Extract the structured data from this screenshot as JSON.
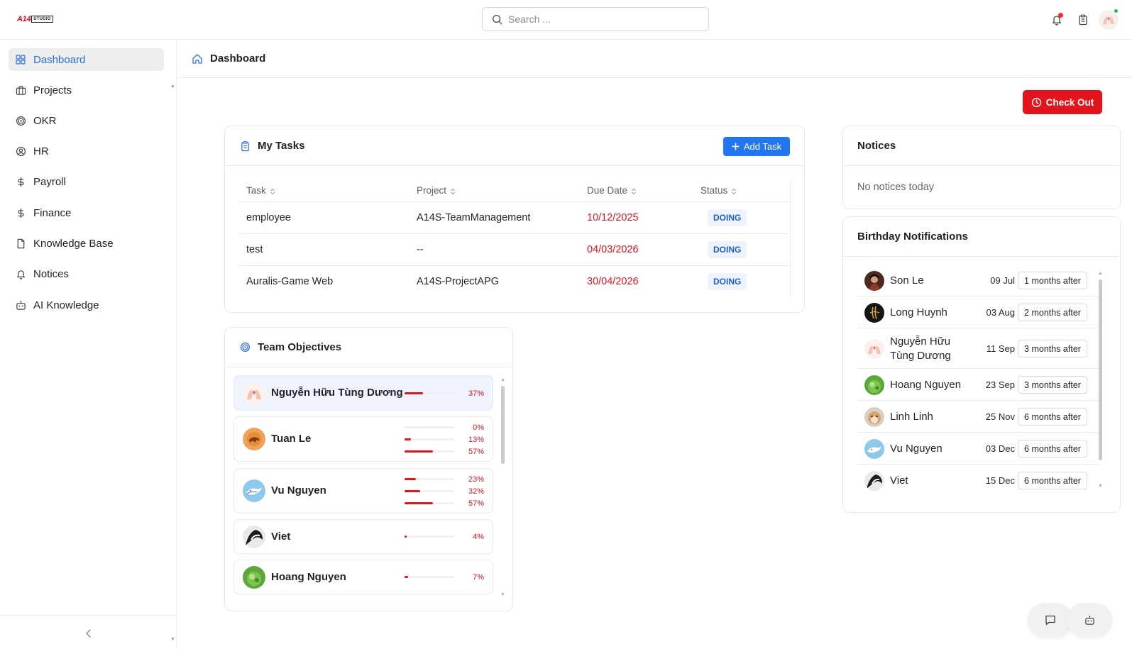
{
  "brand": {
    "logo_main": "A14",
    "logo_sub": "STUDIO"
  },
  "search": {
    "placeholder": "Search ..."
  },
  "topbar": {
    "icons": [
      "bell-icon",
      "clipboard-icon",
      "avatar"
    ],
    "notification_dot_color": "#ff2b2b",
    "online_dot_color": "#1db954"
  },
  "sidebar": {
    "items": [
      {
        "label": "Dashboard",
        "icon": "grid-icon",
        "active": true
      },
      {
        "label": "Projects",
        "icon": "briefcase-icon"
      },
      {
        "label": "OKR",
        "icon": "target-icon"
      },
      {
        "label": "HR",
        "icon": "user-circle-icon"
      },
      {
        "label": "Payroll",
        "icon": "dollar-icon"
      },
      {
        "label": "Finance",
        "icon": "dollar-icon"
      },
      {
        "label": "Knowledge Base",
        "icon": "file-icon"
      },
      {
        "label": "Notices",
        "icon": "bell-icon"
      },
      {
        "label": "AI Knowledge",
        "icon": "robot-icon"
      }
    ]
  },
  "breadcrumb": {
    "title": "Dashboard"
  },
  "checkout": {
    "label": "Check Out",
    "color": "#e4141c"
  },
  "tasks": {
    "title": "My Tasks",
    "add_label": "Add Task",
    "columns": [
      "Task",
      "Project",
      "Due Date",
      "Status"
    ],
    "rows": [
      {
        "task": "employee",
        "project": "A14S-TeamManagement",
        "due": "10/12/2025",
        "status": "DOING"
      },
      {
        "task": "test",
        "project": "--",
        "due": "04/03/2026",
        "status": "DOING"
      },
      {
        "task": "Auralis-Game Web",
        "project": "A14S-ProjectAPG",
        "due": "30/04/2026",
        "status": "DOING"
      }
    ]
  },
  "objectives": {
    "title": "Team Objectives",
    "members": [
      {
        "name": "Nguyễn Hữu Tùng Dương",
        "avatar": "avatar-hands",
        "progress": [
          "37%"
        ],
        "values": [
          0.37
        ],
        "highlighted": true
      },
      {
        "name": "Tuan Le",
        "avatar": "avatar-orange",
        "progress": [
          "0%",
          "13%",
          "57%"
        ],
        "values": [
          0,
          0.13,
          0.57
        ]
      },
      {
        "name": "Vu Nguyen",
        "avatar": "avatar-whale",
        "progress": [
          "23%",
          "32%",
          "57%"
        ],
        "values": [
          0.23,
          0.32,
          0.57
        ]
      },
      {
        "name": "Viet",
        "avatar": "avatar-bw",
        "progress": [
          "4%"
        ],
        "values": [
          0.04
        ]
      },
      {
        "name": "Hoang Nguyen",
        "avatar": "avatar-green",
        "progress": [
          "7%"
        ],
        "values": [
          0.07
        ]
      }
    ]
  },
  "notices": {
    "title": "Notices",
    "empty": "No notices today"
  },
  "birthdays": {
    "title": "Birthday Notifications",
    "rows": [
      {
        "name": "Son Le",
        "date": "09 Jul",
        "tag": "1 months after",
        "avatar": "avatar-photo"
      },
      {
        "name": "Long Huynh",
        "date": "03 Aug",
        "tag": "2 months after",
        "avatar": "avatar-dark"
      },
      {
        "name": "Nguyễn Hữu Tùng Dương",
        "date": "11 Sep",
        "tag": "3 months after",
        "avatar": "avatar-hands"
      },
      {
        "name": "Hoang Nguyen",
        "date": "23 Sep",
        "tag": "3 months after",
        "avatar": "avatar-green"
      },
      {
        "name": "Linh Linh",
        "date": "25 Nov",
        "tag": "6 months after",
        "avatar": "avatar-hamster"
      },
      {
        "name": "Vu Nguyen",
        "date": "03 Dec",
        "tag": "6 months after",
        "avatar": "avatar-whale"
      },
      {
        "name": "Viet",
        "date": "15 Dec",
        "tag": "6 months after",
        "avatar": "avatar-bw"
      }
    ]
  },
  "floating": {
    "icons": [
      "chat-icon",
      "robot-icon"
    ]
  }
}
